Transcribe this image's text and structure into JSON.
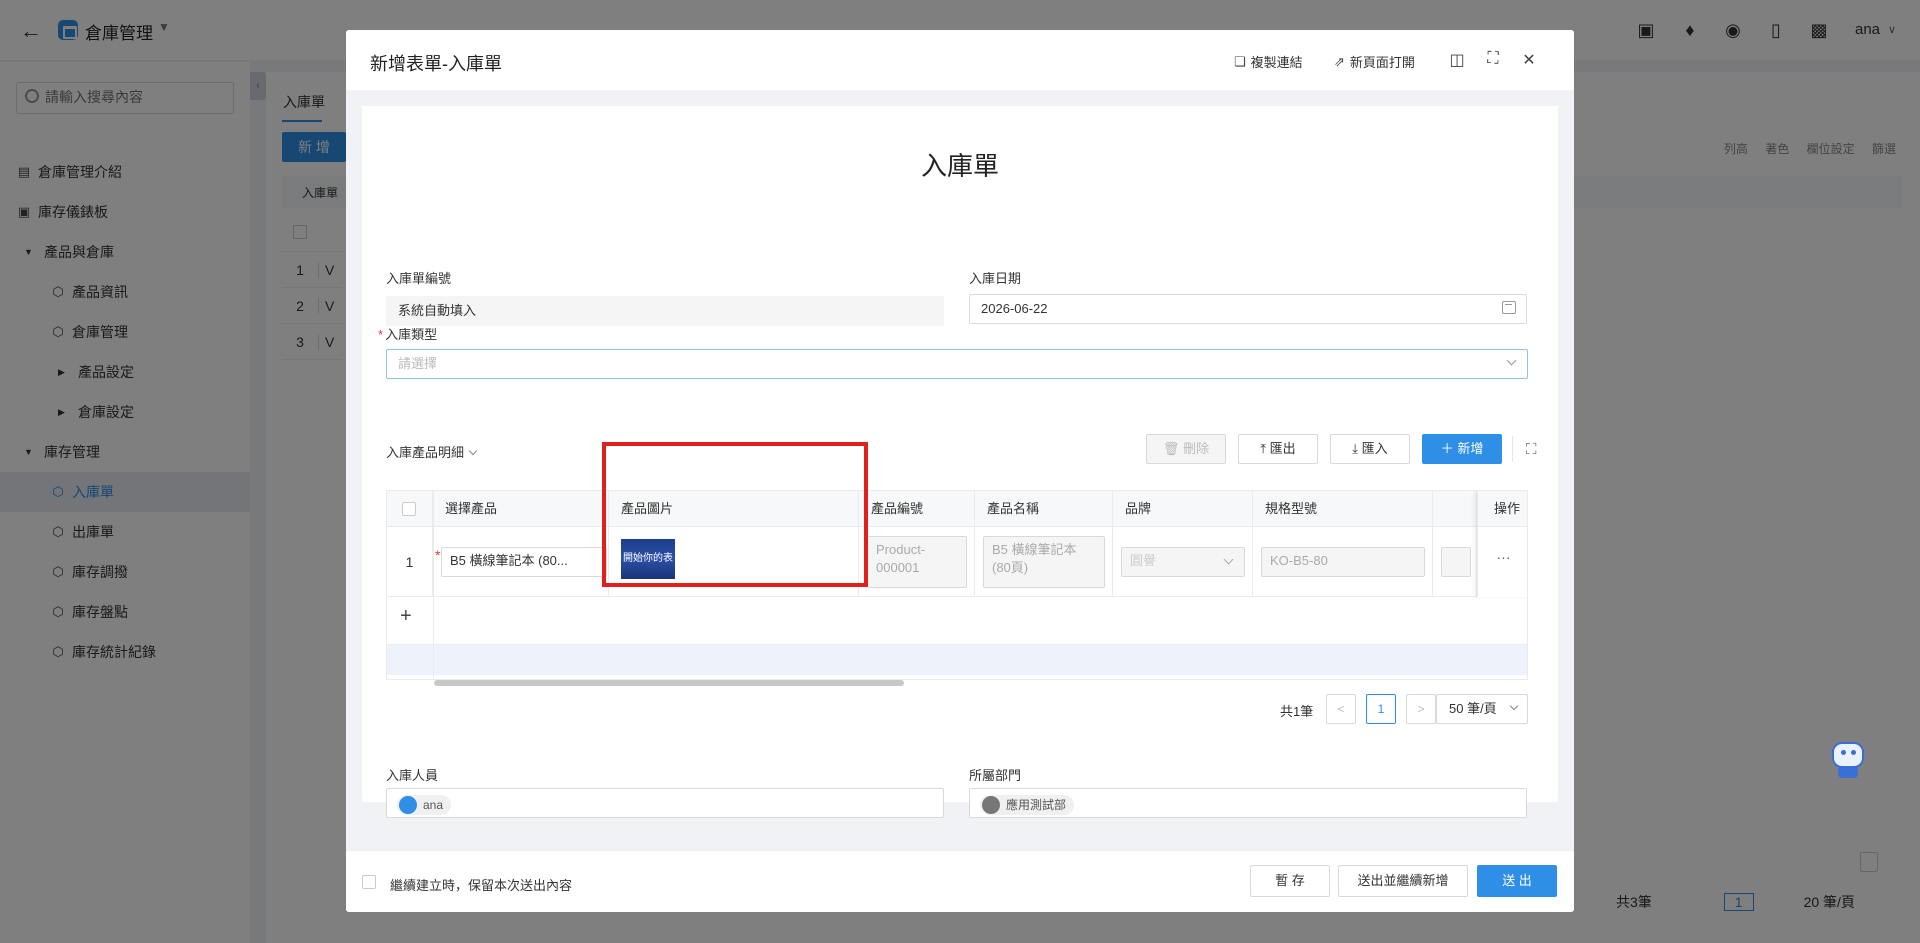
{
  "app": {
    "name": "倉庫管理",
    "user": "ana"
  },
  "sidebar": {
    "search_placeholder": "請輸入搜尋內容",
    "items": [
      {
        "label": "倉庫管理介紹"
      },
      {
        "label": "庫存儀錶板"
      },
      {
        "label": "產品與倉庫"
      },
      {
        "label": "產品資訊"
      },
      {
        "label": "倉庫管理"
      },
      {
        "label": "產品設定"
      },
      {
        "label": "倉庫設定"
      },
      {
        "label": "庫存管理"
      },
      {
        "label": "入庫單"
      },
      {
        "label": "出庫單"
      },
      {
        "label": "庫存調撥"
      },
      {
        "label": "庫存盤點"
      },
      {
        "label": "庫存統計紀錄"
      }
    ]
  },
  "background": {
    "tab": "入庫單",
    "new_button": "新 增",
    "filter_label": "入庫單",
    "tools": [
      "列高",
      "著色",
      "欄位設定",
      "篩選"
    ],
    "rows": [
      {
        "no": "1",
        "val": "V"
      },
      {
        "no": "2",
        "val": "V"
      },
      {
        "no": "3",
        "val": "V"
      }
    ],
    "pager": {
      "total": "共3筆",
      "page": "1",
      "size": "20 筆/頁"
    }
  },
  "modal": {
    "title": "新增表單-入庫單",
    "copy_link": "複製連結",
    "open_new": "新頁面打開",
    "form_title": "入庫單",
    "fields": {
      "no_label": "入庫單編號",
      "no_value": "系統自動填入",
      "date_label": "入庫日期",
      "date_value": "2026-06-22",
      "type_label": "入庫類型",
      "type_placeholder": "請選擇",
      "staff_label": "入庫人員",
      "staff_value": "ana",
      "dept_label": "所屬部門",
      "dept_value": "應用測試部"
    },
    "subtable": {
      "title": "入庫產品明細",
      "btn_delete": "刪除",
      "btn_export": "匯出",
      "btn_import": "匯入",
      "btn_add": "新增",
      "columns": [
        "選擇產品",
        "產品圖片",
        "產品編號",
        "產品名稱",
        "品牌",
        "規格型號",
        "操作"
      ],
      "rows": [
        {
          "no": "1",
          "product": "B5 橫線筆記本 (80...",
          "image_text": "開始你的表",
          "code": "Product-000001",
          "name": "B5 橫線筆記本 (80頁)",
          "brand": "圓譽",
          "spec": "KO-B5-80",
          "op": "···"
        }
      ],
      "pager": {
        "total": "共1筆",
        "prev": "<",
        "page": "1",
        "next": ">",
        "size": "50 筆/頁"
      }
    },
    "footer": {
      "keep_label": "繼續建立時，保留本次送出內容",
      "save": "暫 存",
      "submit_continue": "送出並繼續新增",
      "submit": "送 出"
    }
  }
}
